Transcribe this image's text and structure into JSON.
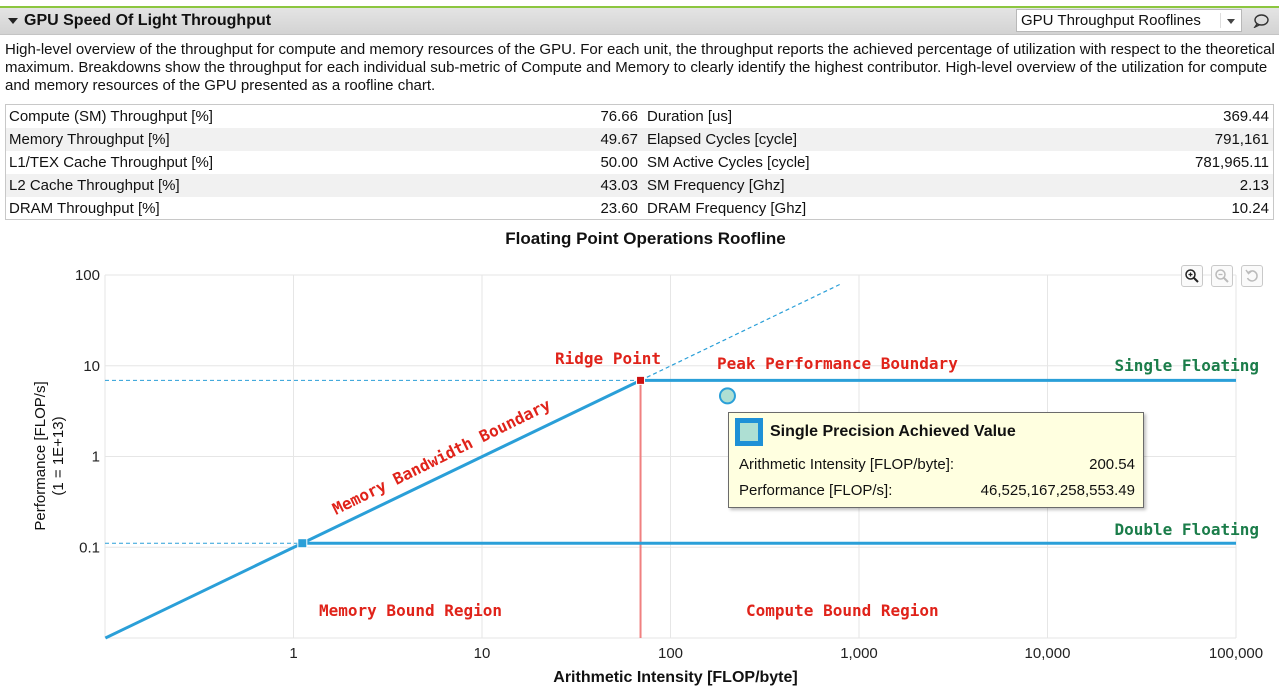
{
  "section": {
    "title": "GPU Speed Of Light Throughput",
    "view_select": "GPU Throughput Rooflines",
    "description": "High-level overview of the throughput for compute and memory resources of the GPU. For each unit, the throughput reports the achieved percentage of utilization with respect to the theoretical maximum. Breakdowns show the throughput for each individual sub-metric of Compute and Memory to clearly identify the highest contributor. High-level overview of the utilization for compute and memory resources of the GPU presented as a roofline chart."
  },
  "metrics": {
    "left": [
      {
        "name": "Compute (SM) Throughput [%]",
        "value": "76.66"
      },
      {
        "name": "Memory Throughput [%]",
        "value": "49.67"
      },
      {
        "name": "L1/TEX Cache Throughput [%]",
        "value": "50.00"
      },
      {
        "name": "L2 Cache Throughput [%]",
        "value": "43.03"
      },
      {
        "name": "DRAM Throughput [%]",
        "value": "23.60"
      }
    ],
    "right": [
      {
        "name": "Duration [us]",
        "value": "369.44"
      },
      {
        "name": "Elapsed Cycles [cycle]",
        "value": "791,161"
      },
      {
        "name": "SM Active Cycles [cycle]",
        "value": "781,965.11"
      },
      {
        "name": "SM Frequency [Ghz]",
        "value": "2.13"
      },
      {
        "name": "DRAM Frequency [Ghz]",
        "value": "10.24"
      }
    ]
  },
  "chart_data": {
    "type": "line",
    "title": "Floating Point Operations Roofline",
    "xlabel": "Arithmetic Intensity [FLOP/byte]",
    "ylabel": "Performance [FLOP/s]",
    "ylabel_scale": "(1 = 1E+13)",
    "x_scale": "log",
    "y_scale": "log",
    "xlim": [
      0.1,
      100000
    ],
    "ylim": [
      0.01,
      100
    ],
    "x_ticks": [
      {
        "v": 1,
        "label": "1"
      },
      {
        "v": 10,
        "label": "10"
      },
      {
        "v": 100,
        "label": "100"
      },
      {
        "v": 1000,
        "label": "1,000"
      },
      {
        "v": 10000,
        "label": "10,000"
      },
      {
        "v": 100000,
        "label": "100,000"
      }
    ],
    "y_ticks": [
      {
        "v": 0.1,
        "label": "0.1"
      },
      {
        "v": 1,
        "label": "1"
      },
      {
        "v": 10,
        "label": "10"
      },
      {
        "v": 100,
        "label": "100"
      }
    ],
    "grid": true,
    "memory_bandwidth_slope": 0.0995,
    "single_peak": 6.9,
    "single_ridge_x": 69.35,
    "double_peak": 0.1108,
    "double_ridge_x": 1.1136,
    "memory_bandwidth_extension_to": 800,
    "achieved_point": {
      "x": 200.54,
      "y": 4.6525
    },
    "colors": {
      "roofline": "#2a9fd8",
      "ridge_line": "#f08080",
      "ridge_marker": "#cc1111",
      "region_label": "#e0231a",
      "precision_label": "#1b7d4a",
      "achieved_fill": "#aedfd3"
    },
    "annotations": {
      "ridge_point": "Ridge Point",
      "peak_performance_boundary": "Peak Performance Boundary",
      "memory_bandwidth_boundary": "Memory Bandwidth Boundary",
      "memory_bound_region": "Memory Bound Region",
      "compute_bound_region": "Compute Bound Region",
      "single_floating": "Single Floating",
      "double_floating": "Double Floating"
    }
  },
  "tooltip": {
    "title": "Single Precision Achieved Value",
    "rows": [
      {
        "label": "Arithmetic Intensity [FLOP/byte]:",
        "value": "200.54"
      },
      {
        "label": "Performance [FLOP/s]:",
        "value": "46,525,167,258,553.49"
      }
    ]
  },
  "toolbar": {
    "zoom_in_icon": "zoom-in-icon",
    "zoom_out_icon": "zoom-out-icon",
    "reset_icon": "reset-zoom-icon"
  }
}
